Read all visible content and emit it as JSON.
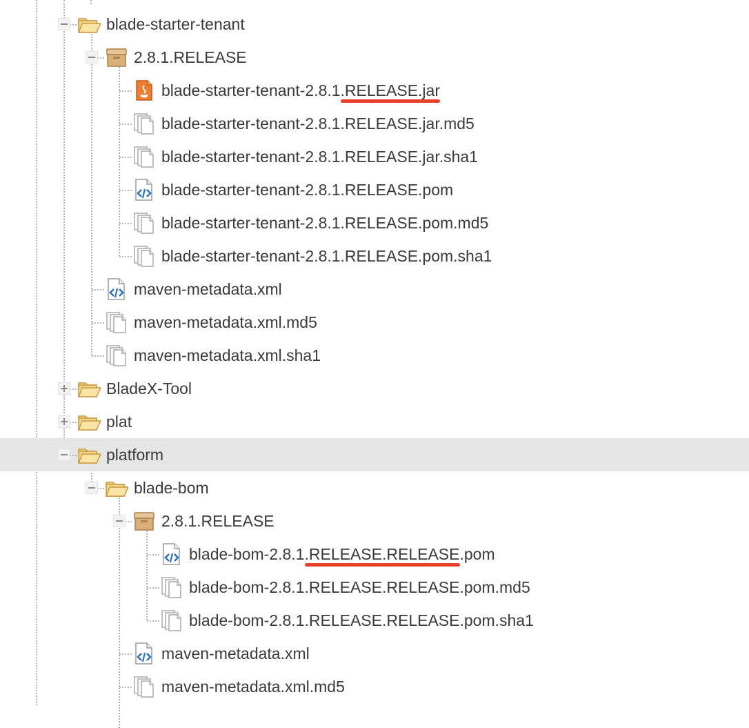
{
  "tree": {
    "items": [
      {
        "label": "blade-starter-tenant",
        "level": 1,
        "icon": "folder-open-icon",
        "toggle": "collapse"
      },
      {
        "label": "2.8.1.RELEASE",
        "level": 2,
        "icon": "package-icon",
        "toggle": "collapse"
      },
      {
        "label": "blade-starter-tenant-2.8.1.RELEASE.jar",
        "level": 3,
        "icon": "jar-file-icon",
        "toggle": null,
        "highlight": ".RELEASE.jar"
      },
      {
        "label": "blade-starter-tenant-2.8.1.RELEASE.jar.md5",
        "level": 3,
        "icon": "generic-file-icon",
        "toggle": null
      },
      {
        "label": "blade-starter-tenant-2.8.1.RELEASE.jar.sha1",
        "level": 3,
        "icon": "generic-file-icon",
        "toggle": null
      },
      {
        "label": "blade-starter-tenant-2.8.1.RELEASE.pom",
        "level": 3,
        "icon": "xml-file-icon",
        "toggle": null
      },
      {
        "label": "blade-starter-tenant-2.8.1.RELEASE.pom.md5",
        "level": 3,
        "icon": "generic-file-icon",
        "toggle": null
      },
      {
        "label": "blade-starter-tenant-2.8.1.RELEASE.pom.sha1",
        "level": 3,
        "icon": "generic-file-icon",
        "toggle": null
      },
      {
        "label": "maven-metadata.xml",
        "level": 2,
        "icon": "xml-file-icon",
        "toggle": null
      },
      {
        "label": "maven-metadata.xml.md5",
        "level": 2,
        "icon": "generic-file-icon",
        "toggle": null
      },
      {
        "label": "maven-metadata.xml.sha1",
        "level": 2,
        "icon": "generic-file-icon",
        "toggle": null
      },
      {
        "label": "BladeX-Tool",
        "level": 1,
        "icon": "folder-open-icon",
        "toggle": "expand"
      },
      {
        "label": "plat",
        "level": 1,
        "icon": "folder-open-icon",
        "toggle": "expand"
      },
      {
        "label": "platform",
        "level": 1,
        "icon": "folder-open-icon",
        "toggle": "collapse",
        "selected": true
      },
      {
        "label": "blade-bom",
        "level": 2,
        "icon": "folder-open-icon",
        "toggle": "collapse"
      },
      {
        "label": "2.8.1.RELEASE",
        "level": 3,
        "icon": "package-icon",
        "toggle": "collapse"
      },
      {
        "label": "blade-bom-2.8.1.RELEASE.RELEASE.pom",
        "level": 4,
        "icon": "xml-file-icon",
        "toggle": null,
        "highlight": ".RELEASE.RELEASE"
      },
      {
        "label": "blade-bom-2.8.1.RELEASE.RELEASE.pom.md5",
        "level": 4,
        "icon": "generic-file-icon",
        "toggle": null
      },
      {
        "label": "blade-bom-2.8.1.RELEASE.RELEASE.pom.sha1",
        "level": 4,
        "icon": "generic-file-icon",
        "toggle": null
      },
      {
        "label": "maven-metadata.xml",
        "level": 3,
        "icon": "xml-file-icon",
        "toggle": null
      },
      {
        "label": "maven-metadata.xml.md5",
        "level": 3,
        "icon": "generic-file-icon",
        "toggle": null
      }
    ]
  },
  "colors": {
    "folder": "#f6d58a",
    "package": "#d9b07a",
    "jar": "#ef7d2e",
    "xml": "#2f74c0",
    "highlight_underline": "#e8412c",
    "selected_row": "#e6e6e6"
  }
}
